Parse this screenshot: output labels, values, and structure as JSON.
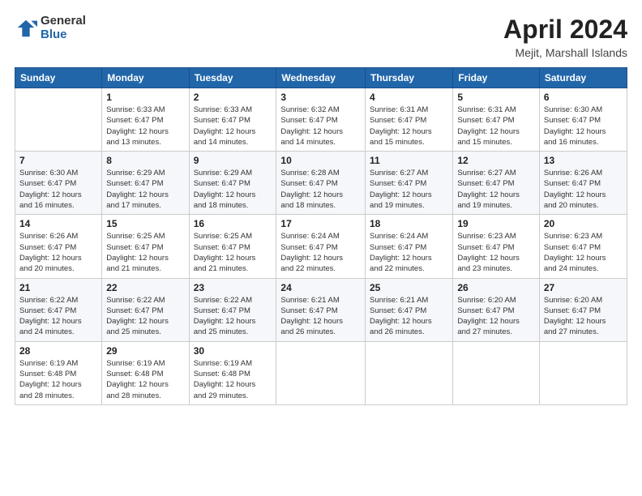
{
  "header": {
    "logo_general": "General",
    "logo_blue": "Blue",
    "title": "April 2024",
    "location": "Mejit, Marshall Islands"
  },
  "days_of_week": [
    "Sunday",
    "Monday",
    "Tuesday",
    "Wednesday",
    "Thursday",
    "Friday",
    "Saturday"
  ],
  "weeks": [
    [
      {
        "num": "",
        "detail": ""
      },
      {
        "num": "1",
        "detail": "Sunrise: 6:33 AM\nSunset: 6:47 PM\nDaylight: 12 hours\nand 13 minutes."
      },
      {
        "num": "2",
        "detail": "Sunrise: 6:33 AM\nSunset: 6:47 PM\nDaylight: 12 hours\nand 14 minutes."
      },
      {
        "num": "3",
        "detail": "Sunrise: 6:32 AM\nSunset: 6:47 PM\nDaylight: 12 hours\nand 14 minutes."
      },
      {
        "num": "4",
        "detail": "Sunrise: 6:31 AM\nSunset: 6:47 PM\nDaylight: 12 hours\nand 15 minutes."
      },
      {
        "num": "5",
        "detail": "Sunrise: 6:31 AM\nSunset: 6:47 PM\nDaylight: 12 hours\nand 15 minutes."
      },
      {
        "num": "6",
        "detail": "Sunrise: 6:30 AM\nSunset: 6:47 PM\nDaylight: 12 hours\nand 16 minutes."
      }
    ],
    [
      {
        "num": "7",
        "detail": "Sunrise: 6:30 AM\nSunset: 6:47 PM\nDaylight: 12 hours\nand 16 minutes."
      },
      {
        "num": "8",
        "detail": "Sunrise: 6:29 AM\nSunset: 6:47 PM\nDaylight: 12 hours\nand 17 minutes."
      },
      {
        "num": "9",
        "detail": "Sunrise: 6:29 AM\nSunset: 6:47 PM\nDaylight: 12 hours\nand 18 minutes."
      },
      {
        "num": "10",
        "detail": "Sunrise: 6:28 AM\nSunset: 6:47 PM\nDaylight: 12 hours\nand 18 minutes."
      },
      {
        "num": "11",
        "detail": "Sunrise: 6:27 AM\nSunset: 6:47 PM\nDaylight: 12 hours\nand 19 minutes."
      },
      {
        "num": "12",
        "detail": "Sunrise: 6:27 AM\nSunset: 6:47 PM\nDaylight: 12 hours\nand 19 minutes."
      },
      {
        "num": "13",
        "detail": "Sunrise: 6:26 AM\nSunset: 6:47 PM\nDaylight: 12 hours\nand 20 minutes."
      }
    ],
    [
      {
        "num": "14",
        "detail": "Sunrise: 6:26 AM\nSunset: 6:47 PM\nDaylight: 12 hours\nand 20 minutes."
      },
      {
        "num": "15",
        "detail": "Sunrise: 6:25 AM\nSunset: 6:47 PM\nDaylight: 12 hours\nand 21 minutes."
      },
      {
        "num": "16",
        "detail": "Sunrise: 6:25 AM\nSunset: 6:47 PM\nDaylight: 12 hours\nand 21 minutes."
      },
      {
        "num": "17",
        "detail": "Sunrise: 6:24 AM\nSunset: 6:47 PM\nDaylight: 12 hours\nand 22 minutes."
      },
      {
        "num": "18",
        "detail": "Sunrise: 6:24 AM\nSunset: 6:47 PM\nDaylight: 12 hours\nand 22 minutes."
      },
      {
        "num": "19",
        "detail": "Sunrise: 6:23 AM\nSunset: 6:47 PM\nDaylight: 12 hours\nand 23 minutes."
      },
      {
        "num": "20",
        "detail": "Sunrise: 6:23 AM\nSunset: 6:47 PM\nDaylight: 12 hours\nand 24 minutes."
      }
    ],
    [
      {
        "num": "21",
        "detail": "Sunrise: 6:22 AM\nSunset: 6:47 PM\nDaylight: 12 hours\nand 24 minutes."
      },
      {
        "num": "22",
        "detail": "Sunrise: 6:22 AM\nSunset: 6:47 PM\nDaylight: 12 hours\nand 25 minutes."
      },
      {
        "num": "23",
        "detail": "Sunrise: 6:22 AM\nSunset: 6:47 PM\nDaylight: 12 hours\nand 25 minutes."
      },
      {
        "num": "24",
        "detail": "Sunrise: 6:21 AM\nSunset: 6:47 PM\nDaylight: 12 hours\nand 26 minutes."
      },
      {
        "num": "25",
        "detail": "Sunrise: 6:21 AM\nSunset: 6:47 PM\nDaylight: 12 hours\nand 26 minutes."
      },
      {
        "num": "26",
        "detail": "Sunrise: 6:20 AM\nSunset: 6:47 PM\nDaylight: 12 hours\nand 27 minutes."
      },
      {
        "num": "27",
        "detail": "Sunrise: 6:20 AM\nSunset: 6:47 PM\nDaylight: 12 hours\nand 27 minutes."
      }
    ],
    [
      {
        "num": "28",
        "detail": "Sunrise: 6:19 AM\nSunset: 6:48 PM\nDaylight: 12 hours\nand 28 minutes."
      },
      {
        "num": "29",
        "detail": "Sunrise: 6:19 AM\nSunset: 6:48 PM\nDaylight: 12 hours\nand 28 minutes."
      },
      {
        "num": "30",
        "detail": "Sunrise: 6:19 AM\nSunset: 6:48 PM\nDaylight: 12 hours\nand 29 minutes."
      },
      {
        "num": "",
        "detail": ""
      },
      {
        "num": "",
        "detail": ""
      },
      {
        "num": "",
        "detail": ""
      },
      {
        "num": "",
        "detail": ""
      }
    ]
  ]
}
